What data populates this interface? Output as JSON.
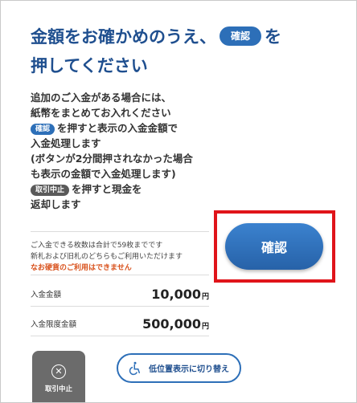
{
  "title": {
    "line1_before": "金額をお確かめのうえ、",
    "confirm_chip": "確認",
    "line1_after": "を",
    "line2": "押してください"
  },
  "instructions": {
    "p1": "追加のご入金がある場合には、",
    "p2": "紙幣をまとめてお入れください",
    "chip_confirm": "確認",
    "p3": "を押すと表示の入金金額で",
    "p4": "入金処理します",
    "p5": "(ボタンが2分間押されなかった場合",
    "p6": "も表示の金額で入金処理します)",
    "chip_cancel": "取引中止",
    "p7": "を押すと現金を",
    "p8": "返却します"
  },
  "note": {
    "line1": "ご入金できる枚数は合計で59枚までです",
    "line2": "新札および旧札のどちらもご利用いただけます",
    "warning": "なお硬貨のご利用はできません"
  },
  "amounts": {
    "deposit_label": "入金金額",
    "deposit_value": "10,000",
    "limit_label": "入金限度金額",
    "limit_value": "500,000",
    "unit": "円"
  },
  "buttons": {
    "confirm": "確認",
    "cancel": "取引中止",
    "low_position": "低位置表示に切り替え"
  },
  "icons": {
    "cancel": "close-circle-icon",
    "low_position": "wheelchair-icon"
  },
  "colors": {
    "title": "#1f4f8f",
    "accent": "#2d6fb8",
    "highlight": "#e0141a",
    "warning": "#d9531e",
    "cancel_bg": "#6b6b6b"
  }
}
